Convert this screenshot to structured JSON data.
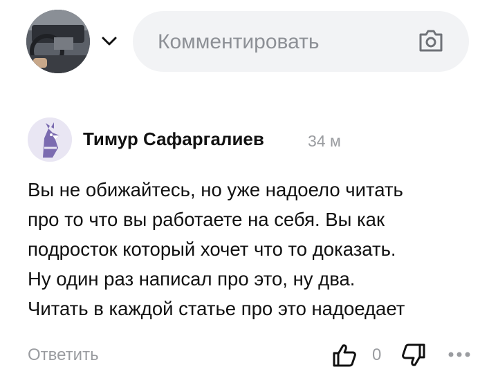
{
  "composer": {
    "placeholder": "Комментировать",
    "avatar_icon": "user-avatar-car-dashboard",
    "chevron_icon": "chevron-down-icon",
    "camera_icon": "camera-icon"
  },
  "comment": {
    "author": "Тимур Сафаргалиев",
    "time": "34 м",
    "avatar_icon": "parrot-avatar-icon",
    "lines": [
      "Вы не обижайтесь, но уже надоело читать",
      "про то что вы работаете на себя. Вы как",
      "подросток который хочет что то доказать.",
      "Ну один раз написал про это, ну два.",
      "Читать в каждой статье про это надоедает"
    ],
    "reply_label": "Ответить",
    "like_count": "0",
    "like_icon": "thumbs-up-icon",
    "dislike_icon": "thumbs-down-icon",
    "more_icon": "more-dots-icon"
  },
  "colors": {
    "muted": "#9a9ca0",
    "field_bg": "#f2f3f5",
    "avatar_purple": "#7b6bb0"
  }
}
